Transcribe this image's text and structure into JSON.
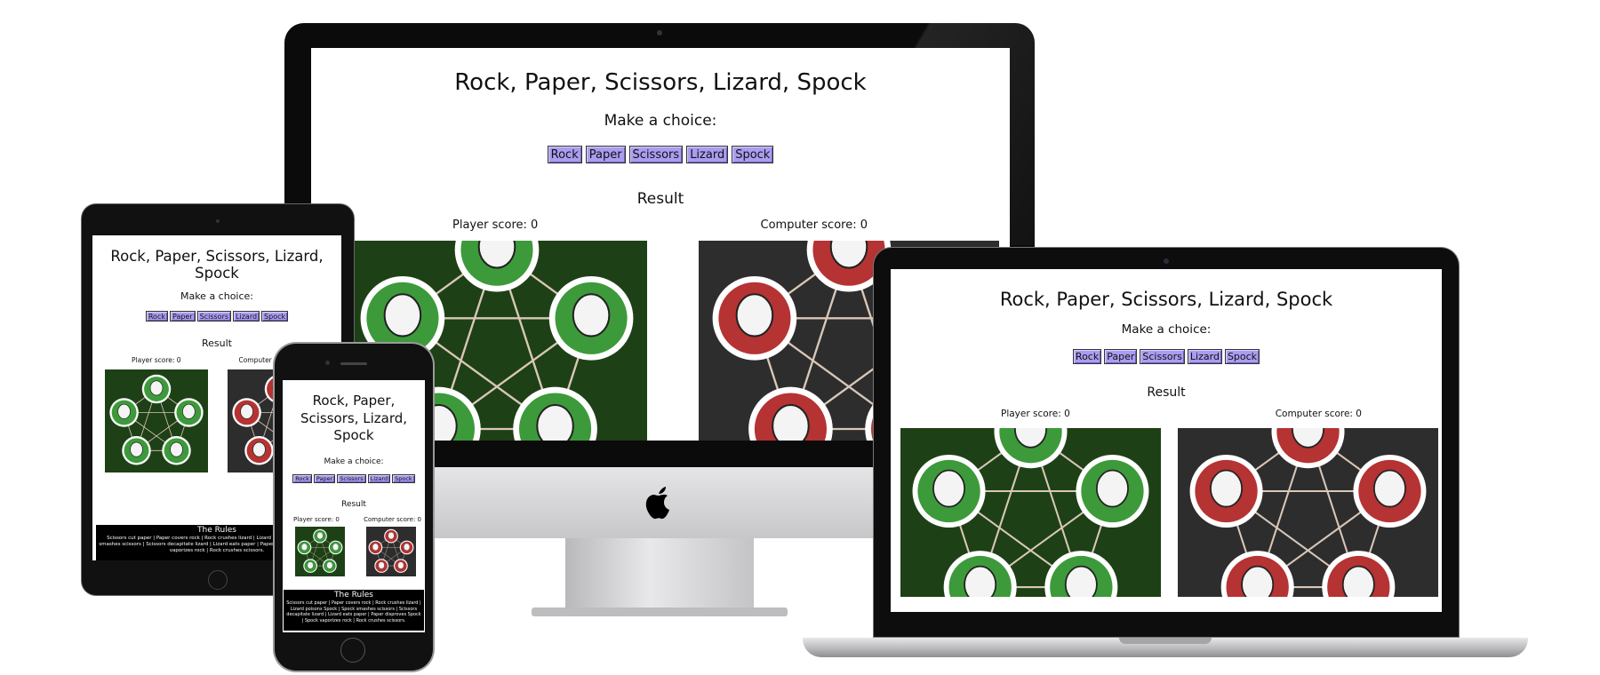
{
  "app": {
    "title": "Rock, Paper, Scissors, Lizard, Spock",
    "prompt": "Make a choice:",
    "buttons": [
      "Rock",
      "Paper",
      "Scissors",
      "Lizard",
      "Spock"
    ],
    "result_heading": "Result",
    "player_score": "Player score: 0",
    "computer_score": "Computer score: 0",
    "rules_title": "The Rules",
    "rules_text": "Scissors cut paper | Paper covers rock | Rock crushes lizard | Lizard poisons Spock | Spock smashes scissors | Scissors decapitate lizard | Lizard eats paper | Paper disproves Spock | Spock vaporizes rock | Rock crushes scissors."
  },
  "colors": {
    "button_bg": "#aa9df0",
    "player_panel_bg": "#1e4016",
    "player_circle": "#3d9a3a",
    "computer_panel_bg": "#2d2d2d",
    "computer_circle": "#b53333",
    "rules_bg": "#000000"
  },
  "devices": [
    "imac",
    "ipad",
    "iphone",
    "macbook"
  ],
  "icons": {
    "brand": "apple-logo-icon",
    "player_image": "rpsls-diagram-green",
    "computer_image": "rpsls-diagram-red"
  }
}
